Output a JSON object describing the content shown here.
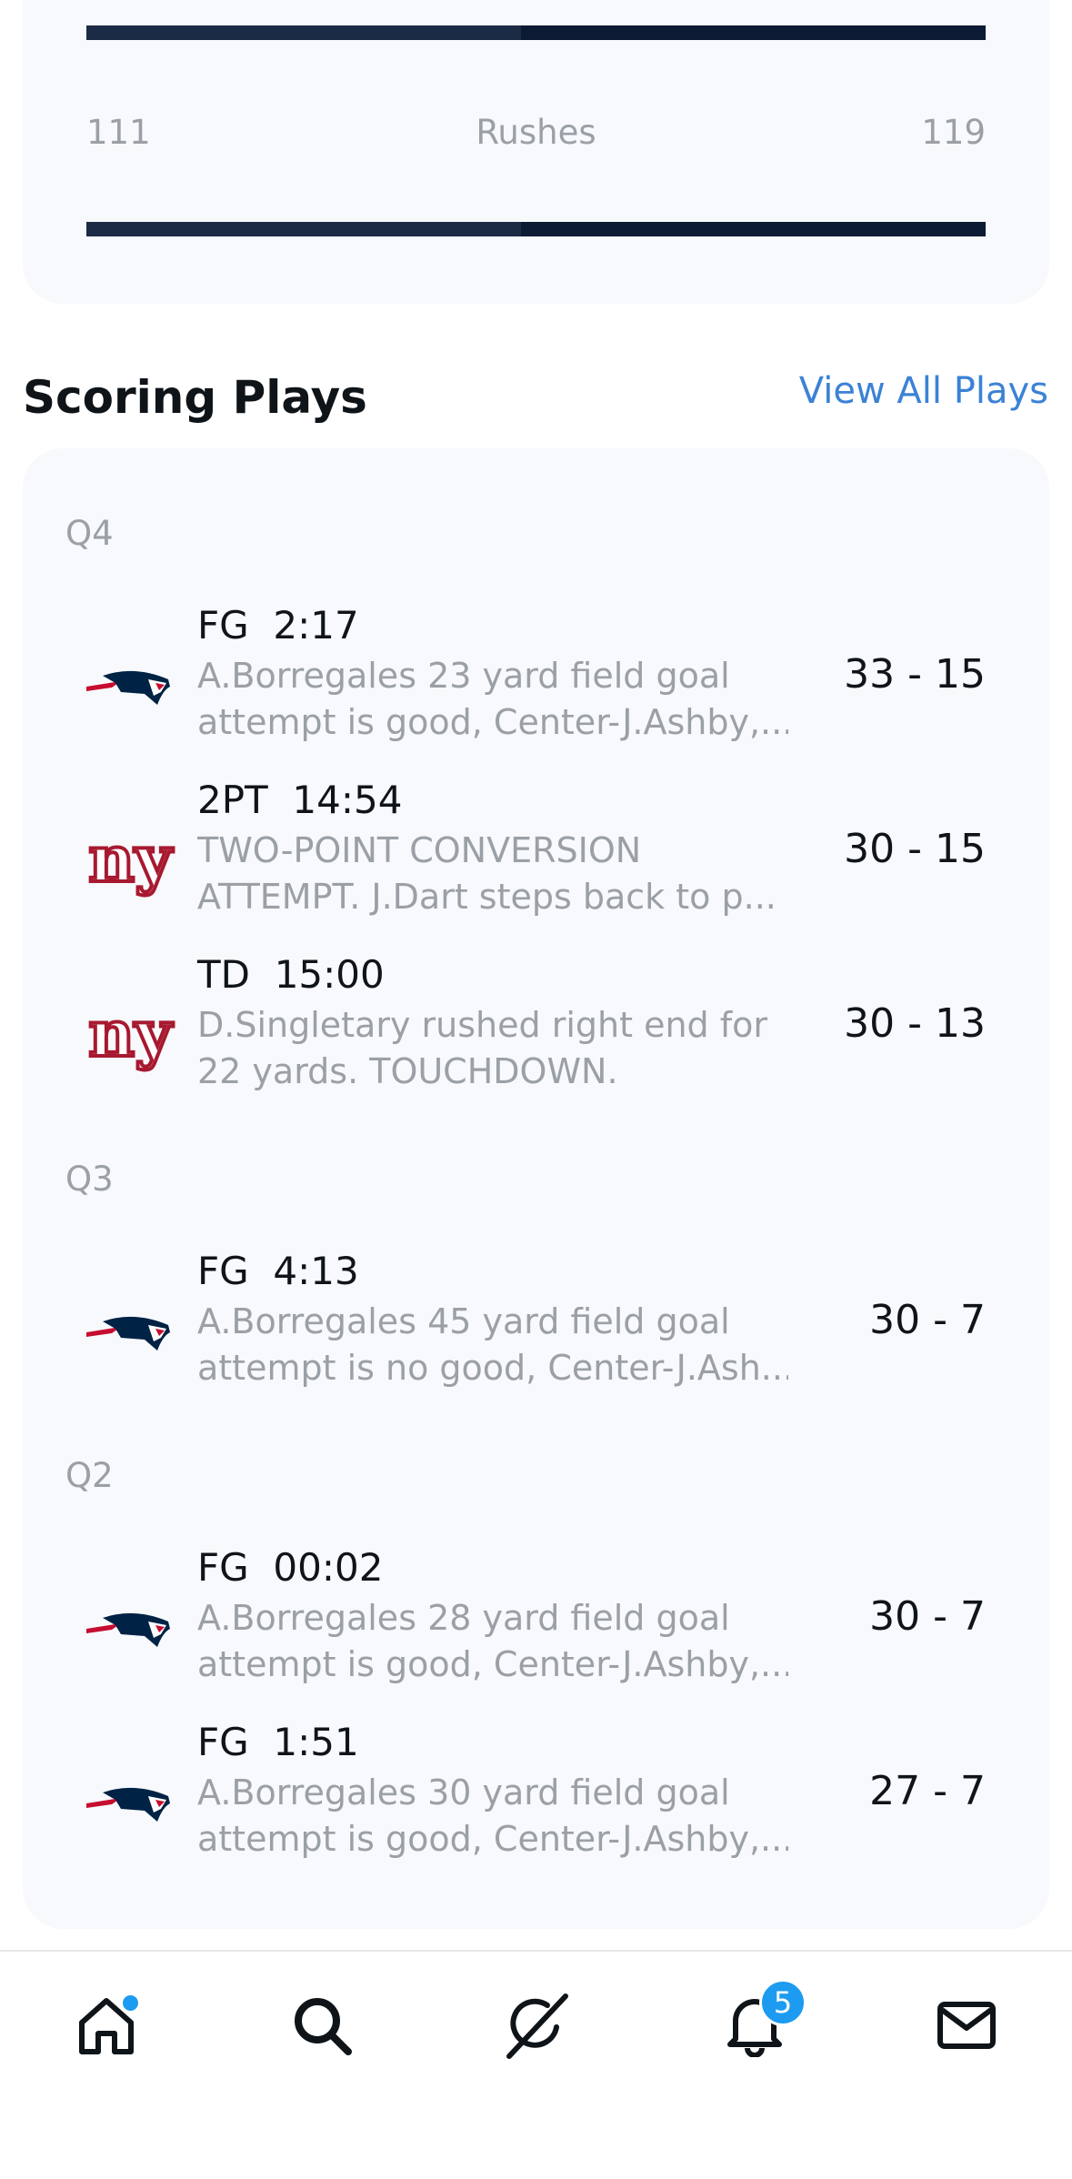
{
  "stats": {
    "rushes": {
      "label": "Rushes",
      "home": "111",
      "away": "119",
      "home_share": 0.483
    }
  },
  "scoring": {
    "title": "Scoring Plays",
    "view_all": "View All Plays",
    "quarters": [
      {
        "label": "Q4"
      },
      {
        "label": "Q3"
      },
      {
        "label": "Q2"
      }
    ],
    "plays": [
      {
        "team": "patriots",
        "head": "FG  2:17",
        "desc1": "A.Borregales 23 yard field goal",
        "desc2": "attempt is good, Center-J.Ashby,...",
        "score": "33 - 15"
      },
      {
        "team": "giants",
        "head": "2PT  14:54",
        "desc1": "TWO-POINT CONVERSION",
        "desc2": "ATTEMPT. J.Dart steps back to p...",
        "score": "30 - 15"
      },
      {
        "team": "giants",
        "head": "TD  15:00",
        "desc1": "D.Singletary rushed right end for",
        "desc2": "22 yards. TOUCHDOWN.",
        "score": "30 - 13"
      },
      {
        "team": "patriots",
        "head": "FG  4:13",
        "desc1": "A.Borregales 45 yard field goal",
        "desc2": "attempt is no good, Center-J.Ash...",
        "score": "30 - 7"
      },
      {
        "team": "patriots",
        "head": "FG  00:02",
        "desc1": "A.Borregales 28 yard field goal",
        "desc2": "attempt is good, Center-J.Ashby,...",
        "score": "30 - 7"
      },
      {
        "team": "patriots",
        "head": "FG  1:51",
        "desc1": "A.Borregales 30 yard field goal",
        "desc2": "attempt is good, Center-J.Ashby,...",
        "score": "27 - 7"
      }
    ]
  },
  "nav": {
    "notifications_badge": "5",
    "items": [
      "home-icon",
      "search-icon",
      "grok-icon",
      "bell-icon",
      "mail-icon"
    ]
  },
  "colors": {
    "accent": "#1d9bf0",
    "link": "#3b82d6",
    "giants_red": "#a71930",
    "patriots_navy": "#002244",
    "patriots_red": "#c60c30"
  }
}
